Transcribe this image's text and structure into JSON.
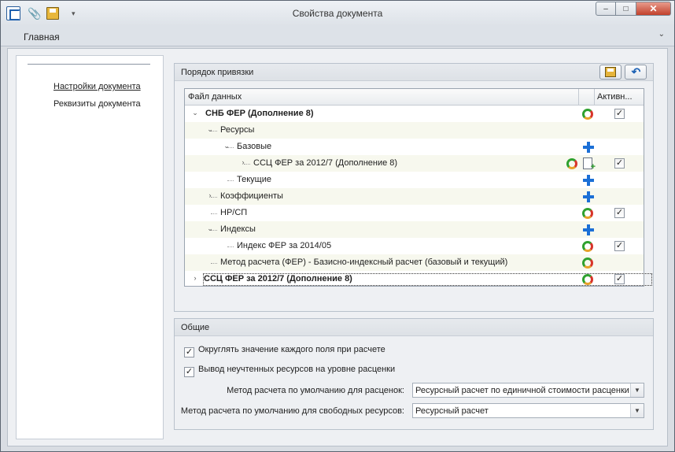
{
  "window": {
    "title": "Свойства документа",
    "quick_access": [
      "app-icon",
      "clip-icon",
      "save-icon",
      "dropdown-icon"
    ],
    "controls": {
      "minimize": "–",
      "maximize": "□",
      "close": "✕"
    }
  },
  "ribbon": {
    "tab": "Главная",
    "collapse": "⌄"
  },
  "nav": {
    "items": [
      {
        "label": "Настройки документа",
        "active": true
      },
      {
        "label": "Реквизиты документа",
        "active": false
      }
    ]
  },
  "binding": {
    "title": "Порядок привязки",
    "columns": {
      "data": "Файл данных",
      "active": "Активн..."
    },
    "rows": [
      {
        "label": "СНБ ФЕР (Дополнение 8)",
        "bold": true,
        "expand": "⌄",
        "icon": "refresh-icon",
        "checked": true
      },
      {
        "label": "Ресурсы",
        "bold": false,
        "expand": "⌄",
        "icon": "",
        "checked": null
      },
      {
        "label": "Базовые",
        "bold": false,
        "expand": "⌄",
        "icon": "plus-icon",
        "checked": null
      },
      {
        "label": "ССЦ ФЕР за 2012/7 (Дополнение 8)",
        "bold": false,
        "expand": "›",
        "icon": "refresh-icon",
        "checked": true
      },
      {
        "label": "Текущие",
        "bold": false,
        "expand": "",
        "icon": "plus-icon",
        "checked": null
      },
      {
        "label": "Коэффициенты",
        "bold": false,
        "expand": "›",
        "icon": "plus-icon",
        "checked": null
      },
      {
        "label": "НР/СП",
        "bold": false,
        "expand": "",
        "icon": "refresh-icon",
        "checked": true
      },
      {
        "label": "Индексы",
        "bold": false,
        "expand": "⌄",
        "icon": "plus-icon",
        "checked": null
      },
      {
        "label": "Индекс ФЕР за 2014/05",
        "bold": false,
        "expand": "",
        "icon": "refresh-icon",
        "checked": true
      },
      {
        "label": "Метод расчета (ФЕР) - Базисно-индексный расчет (базовый и текущий)",
        "bold": false,
        "expand": "",
        "icon": "refresh-icon",
        "checked": null
      },
      {
        "label": "ССЦ ФЕР за 2012/7 (Дополнение 8)",
        "bold": true,
        "expand": "›",
        "icon": "refresh-icon",
        "checked": true
      }
    ]
  },
  "general": {
    "title": "Общие",
    "options": [
      {
        "label": "Округлять значение каждого поля при расчете",
        "checked": true
      },
      {
        "label": "Вывод неучтенных ресурсов на уровне расценки",
        "checked": true
      }
    ],
    "fields": [
      {
        "label": "Метод расчета по умолчанию для расценок:",
        "value": "Ресурсный расчет по единичной стоимости расценки"
      },
      {
        "label": "Метод расчета по умолчанию для свободных ресурсов:",
        "value": "Ресурсный расчет"
      }
    ]
  },
  "check_glyph": "✓",
  "dropdown_glyph": "▼"
}
